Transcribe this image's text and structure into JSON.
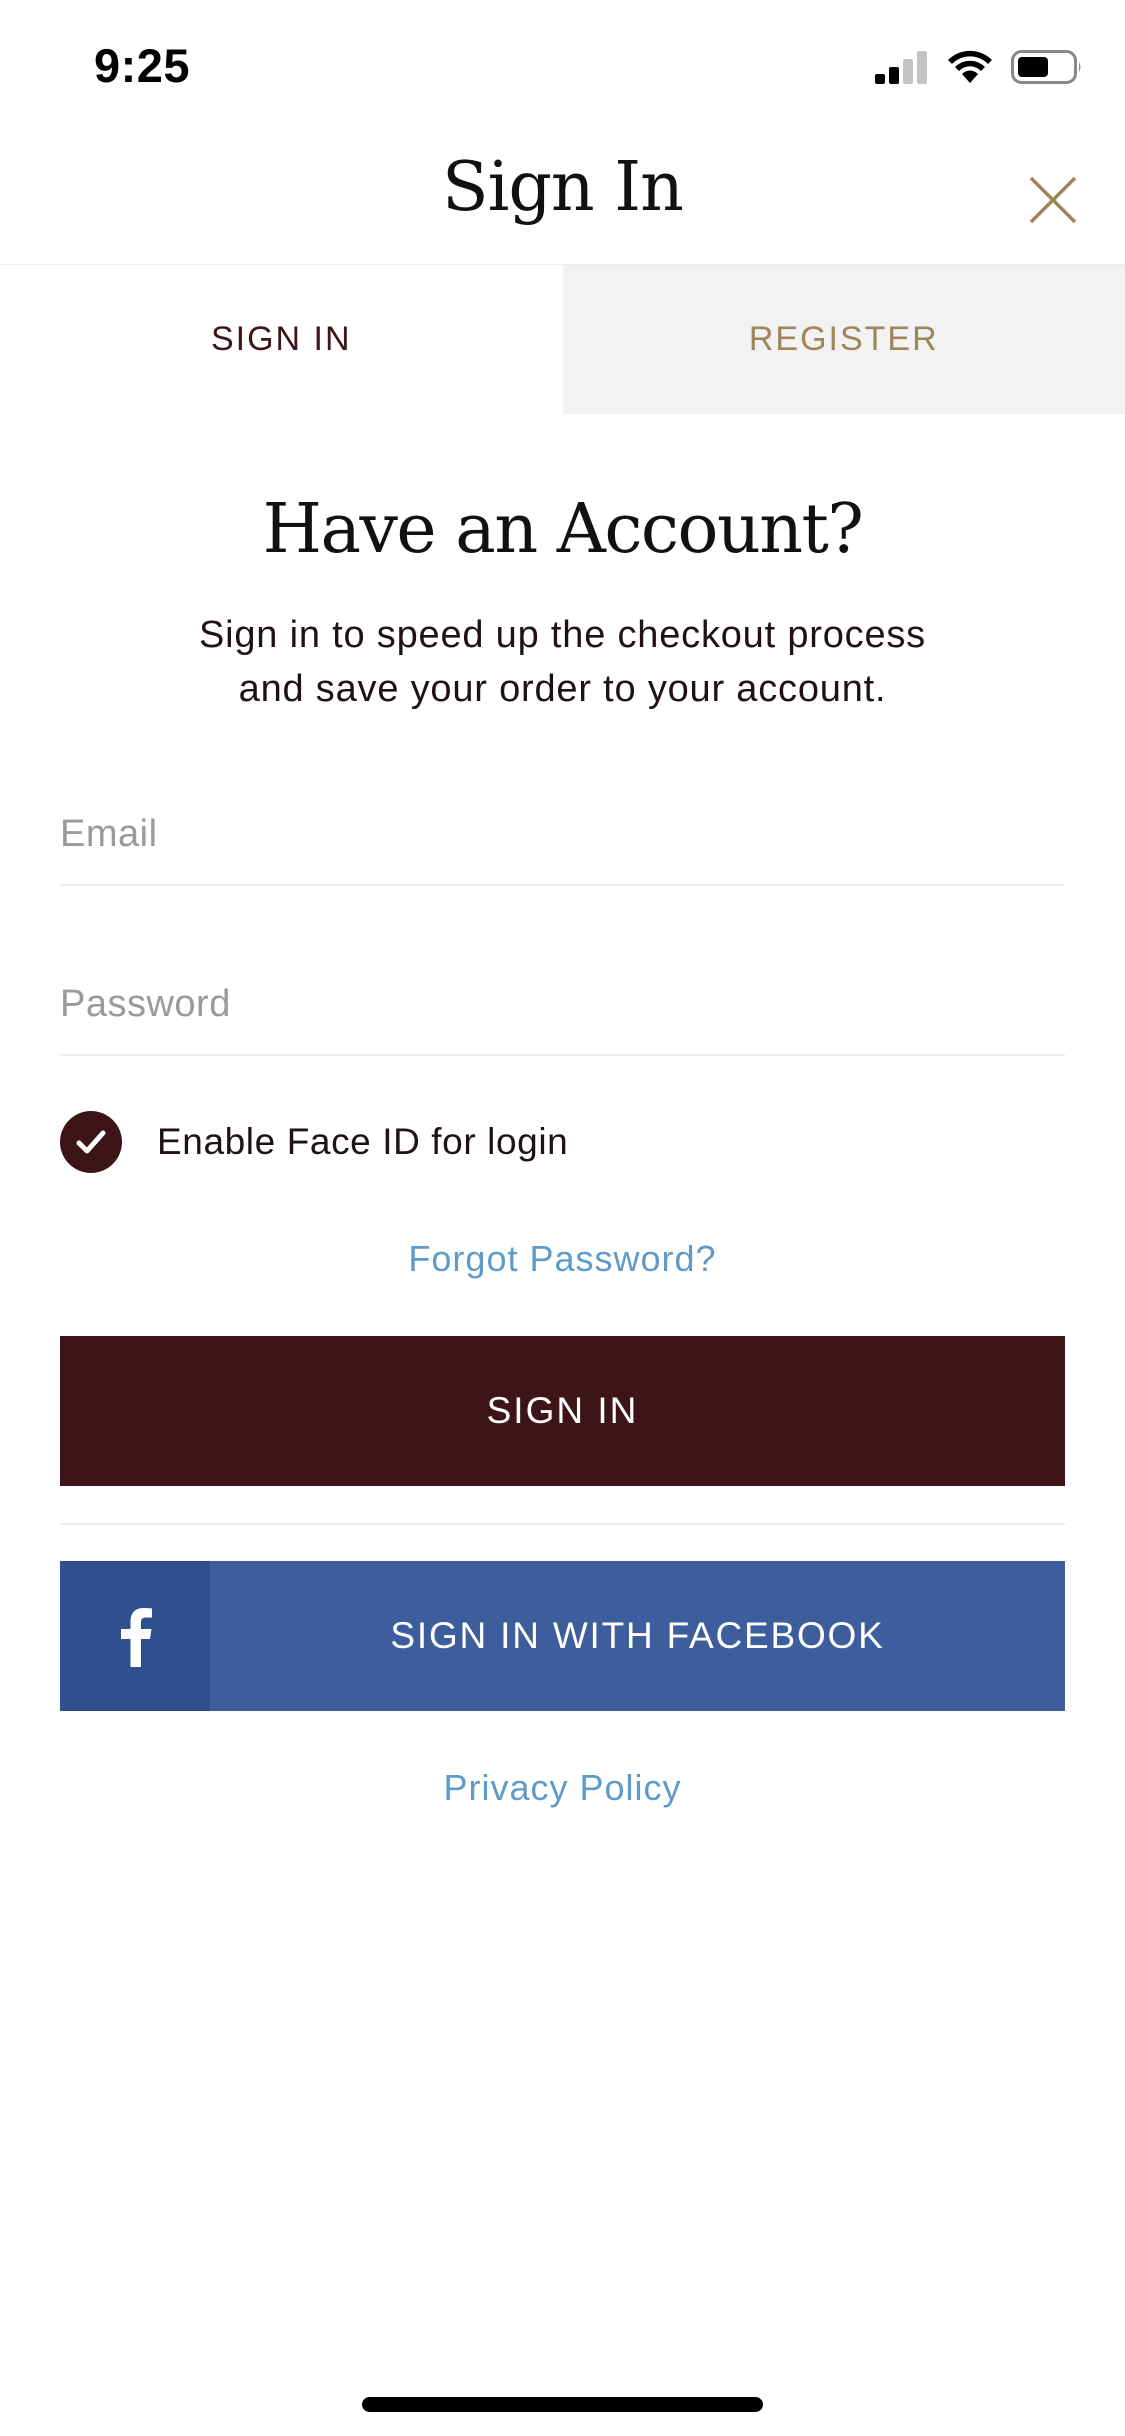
{
  "status_bar": {
    "time": "9:25",
    "icons": [
      "cellular-signal-icon",
      "wifi-icon",
      "battery-icon"
    ]
  },
  "header": {
    "title": "Sign In",
    "close_icon": "close-icon"
  },
  "tabs": [
    {
      "label": "SIGN IN",
      "active": true
    },
    {
      "label": "REGISTER",
      "active": false
    }
  ],
  "content": {
    "heading": "Have an Account?",
    "subtext_line1": "Sign in to speed up the checkout process",
    "subtext_line2": "and save your order to your account."
  },
  "form": {
    "email_placeholder": "Email",
    "email_value": "",
    "password_placeholder": "Password",
    "password_value": "",
    "faceid_label": "Enable Face ID for login",
    "faceid_checked": true,
    "forgot_password": "Forgot Password?",
    "signin_button": "SIGN IN",
    "facebook_button": "SIGN IN WITH FACEBOOK",
    "privacy_policy": "Privacy Policy"
  },
  "colors": {
    "brand_maroon": "#3d1519",
    "gold_accent": "#a08559",
    "link_blue": "#5e9bc9",
    "facebook_blue": "#3d5d9c",
    "facebook_dark_blue": "#2f4f8f",
    "inactive_tab_bg": "#f2f2f2"
  }
}
